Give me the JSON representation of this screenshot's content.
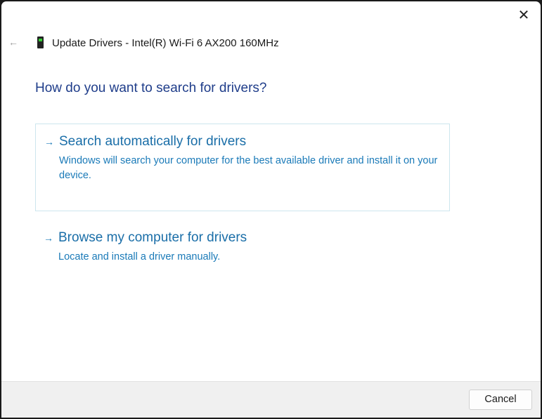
{
  "dialog": {
    "title": "Update Drivers - Intel(R) Wi-Fi 6 AX200 160MHz",
    "heading": "How do you want to search for drivers?",
    "back_icon": "←",
    "close_icon": "✕",
    "options": [
      {
        "arrow": "→",
        "title": "Search automatically for drivers",
        "description": "Windows will search your computer for the best available driver and install it on your device."
      },
      {
        "arrow": "→",
        "title": "Browse my computer for drivers",
        "description": "Locate and install a driver manually."
      }
    ],
    "cancel_label": "Cancel"
  }
}
